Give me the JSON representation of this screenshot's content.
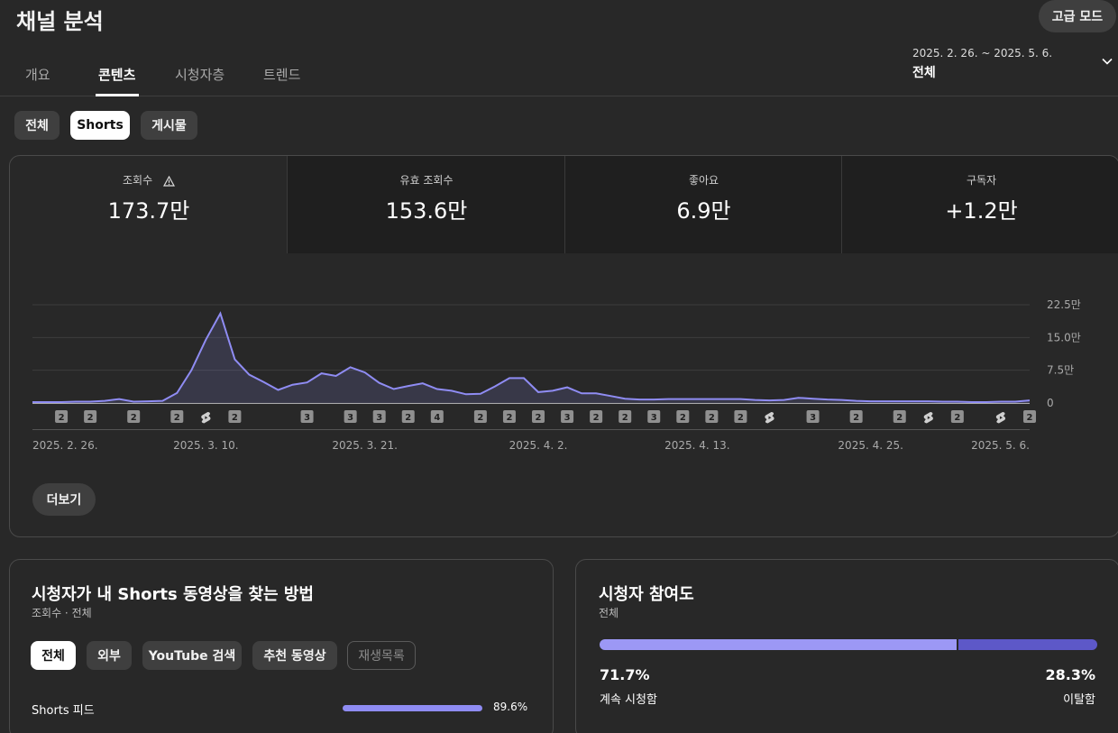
{
  "header": {
    "title": "채널 분석",
    "advanced_mode_label": "고급 모드"
  },
  "tabs": [
    {
      "label": "개요",
      "active": false
    },
    {
      "label": "콘텐츠",
      "active": true
    },
    {
      "label": "시청자층",
      "active": false
    },
    {
      "label": "트렌드",
      "active": false
    }
  ],
  "date_picker": {
    "range": "2025. 2. 26. ~ 2025. 5. 6.",
    "label": "전체",
    "icon": "chevron-down-icon"
  },
  "content_chips": [
    {
      "label": "전체",
      "selected": false
    },
    {
      "label": "Shorts",
      "selected": true
    },
    {
      "label": "게시물",
      "selected": false
    }
  ],
  "metrics": [
    {
      "label": "조회수",
      "value": "173.7만",
      "icon": "warning-icon",
      "selected": true
    },
    {
      "label": "유효 조회수",
      "value": "153.6만",
      "selected": false
    },
    {
      "label": "좋아요",
      "value": "6.9만",
      "selected": false
    },
    {
      "label": "구독자",
      "value": "+1.2만",
      "selected": false
    }
  ],
  "chart_data": {
    "type": "area",
    "series_color": "#8f8cf3",
    "y_tick_labels": [
      "22.5만",
      "15.0만",
      "7.5만",
      "0"
    ],
    "y_ticks": [
      225000,
      150000,
      75000,
      0
    ],
    "ylim": [
      0,
      225000
    ],
    "x_tick_labels": [
      "2025. 2. 26.",
      "2025. 3. 10.",
      "2025. 3. 21.",
      "2025. 4. 2.",
      "2025. 4. 13.",
      "2025. 4. 25.",
      "2025. 5. 6."
    ],
    "x_tick_days": [
      0,
      12,
      23,
      35,
      46,
      58,
      69
    ],
    "x_start": "2025. 2. 26.",
    "x_end": "2025. 5. 6.",
    "values": [
      2000,
      2000,
      2000,
      3000,
      3000,
      5000,
      9000,
      3000,
      4000,
      5000,
      23000,
      75000,
      145000,
      205000,
      100000,
      65000,
      48000,
      30000,
      42000,
      47000,
      68000,
      62000,
      82000,
      70000,
      46000,
      32000,
      39000,
      45000,
      32000,
      28000,
      20000,
      21000,
      38000,
      57000,
      57000,
      25000,
      28000,
      36000,
      22000,
      22000,
      16000,
      10000,
      8000,
      8000,
      9000,
      9000,
      9000,
      9000,
      9000,
      9000,
      7000,
      6000,
      7000,
      12000,
      10000,
      8000,
      7000,
      5000,
      4000,
      4000,
      4000,
      4000,
      4000,
      3000,
      3000,
      2000,
      2000,
      3000,
      3000,
      6000
    ],
    "upload_markers": [
      {
        "day": 2,
        "label": "2"
      },
      {
        "day": 4,
        "label": "2"
      },
      {
        "day": 7,
        "label": "2"
      },
      {
        "day": 10,
        "label": "2"
      },
      {
        "day": 12,
        "label": "shorts"
      },
      {
        "day": 14,
        "label": "2"
      },
      {
        "day": 19,
        "label": "3"
      },
      {
        "day": 22,
        "label": "3"
      },
      {
        "day": 24,
        "label": "3"
      },
      {
        "day": 26,
        "label": "2"
      },
      {
        "day": 28,
        "label": "4"
      },
      {
        "day": 31,
        "label": "2"
      },
      {
        "day": 33,
        "label": "2"
      },
      {
        "day": 35,
        "label": "2"
      },
      {
        "day": 37,
        "label": "3"
      },
      {
        "day": 39,
        "label": "2"
      },
      {
        "day": 41,
        "label": "2"
      },
      {
        "day": 43,
        "label": "3"
      },
      {
        "day": 45,
        "label": "2"
      },
      {
        "day": 47,
        "label": "2"
      },
      {
        "day": 49,
        "label": "2"
      },
      {
        "day": 51,
        "label": "shorts"
      },
      {
        "day": 54,
        "label": "3"
      },
      {
        "day": 57,
        "label": "2"
      },
      {
        "day": 60,
        "label": "2"
      },
      {
        "day": 62,
        "label": "shorts"
      },
      {
        "day": 64,
        "label": "2"
      },
      {
        "day": 67,
        "label": "shorts"
      },
      {
        "day": 69,
        "label": "2"
      }
    ]
  },
  "more_button_label": "더보기",
  "traffic_card": {
    "title": "시청자가 내 Shorts 동영상을 찾는 방법",
    "subtitle": "조회수 · 전체",
    "filters": [
      {
        "label": "전체",
        "state": "selected"
      },
      {
        "label": "외부",
        "state": "normal"
      },
      {
        "label": "YouTube 검색",
        "state": "normal"
      },
      {
        "label": "추천 동영상",
        "state": "normal"
      },
      {
        "label": "재생목록",
        "state": "outline"
      }
    ],
    "rows": [
      {
        "label": "Shorts 피드",
        "percent": "89.6%",
        "fraction": 0.896
      }
    ]
  },
  "engagement_card": {
    "title": "시청자 참여도",
    "subtitle": "전체",
    "stay": {
      "percent": "71.7%",
      "label": "계속 시청함",
      "fraction": 0.717
    },
    "leave": {
      "percent": "28.3%",
      "label": "이탈함"
    }
  }
}
